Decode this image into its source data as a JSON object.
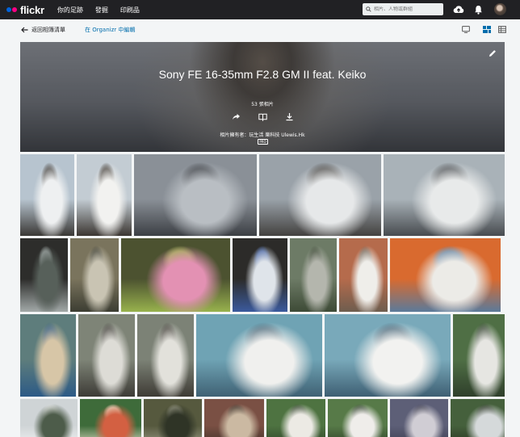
{
  "nav": {
    "logo": "flickr",
    "items": [
      "你的足跡",
      "發掘",
      "印刷品"
    ],
    "search_placeholder": "相片、人物或群組"
  },
  "toolbar": {
    "back_label": "返回相簿清單",
    "organizr_label": "在 Organizr 中編輯"
  },
  "album": {
    "title": "Sony FE 16-35mm F2.8 GM II feat. Keiko",
    "count": "53 張相片",
    "owner": "相片擁有者：玩生活 樂科技 Ulewis.Hk",
    "license": "PRO"
  },
  "colors": {
    "brand_blue": "#0063dc",
    "brand_pink": "#ff0084",
    "link": "#006dac",
    "topbar": "#212124"
  },
  "photos": [
    {
      "row": 1,
      "subject": "girl with clear umbrella, sea and sky",
      "palette": [
        "#b7c4cf",
        "#eef0f1",
        "#3a3835"
      ]
    },
    {
      "row": 1,
      "subject": "girl with clear umbrella close-up",
      "palette": [
        "#c3ccd3",
        "#f2f2f0",
        "#3b3631"
      ]
    },
    {
      "row": 1,
      "subject": "clear umbrella over harbour",
      "palette": [
        "#8a9097",
        "#b9bec3",
        "#3c3f44"
      ]
    },
    {
      "row": 1,
      "subject": "girl in white under umbrella, ferry",
      "palette": [
        "#9aa2a9",
        "#e6e8e9",
        "#43413f"
      ]
    },
    {
      "row": 1,
      "subject": "girl with umbrella by the pier",
      "palette": [
        "#a9b2b8",
        "#e8eaea",
        "#474b4f"
      ]
    },
    {
      "row": 2,
      "subject": "balcony railing with trees",
      "palette": [
        "#2d2d2b",
        "#57605a",
        "#a2a9a8"
      ]
    },
    {
      "row": 2,
      "subject": "old building with hanging plants",
      "palette": [
        "#7a745d",
        "#c9c4b3",
        "#3c3d32"
      ]
    },
    {
      "row": 2,
      "subject": "pink toy with green leaves",
      "palette": [
        "#4c5230",
        "#e391b3",
        "#98b24d"
      ]
    },
    {
      "row": 2,
      "subject": "blue and white ceramic figure",
      "palette": [
        "#2c2b29",
        "#dfe4ea",
        "#3b5a9d"
      ]
    },
    {
      "row": 2,
      "subject": "village house with greenery",
      "palette": [
        "#6d7b66",
        "#b4b6ad",
        "#3d4a36"
      ]
    },
    {
      "row": 2,
      "subject": "girl sitting by red wall",
      "palette": [
        "#b56b4c",
        "#efeeea",
        "#6e5d4e"
      ]
    },
    {
      "row": 2,
      "subject": "girl with orange crates",
      "palette": [
        "#d96a2f",
        "#ecebe7",
        "#5b7a9a"
      ]
    },
    {
      "row": 3,
      "subject": "graffiti wall",
      "palette": [
        "#5e7d7c",
        "#d7c6a7",
        "#2c5a86"
      ]
    },
    {
      "row": 3,
      "subject": "girl with umbrella near plants",
      "palette": [
        "#7e8477",
        "#dddcd6",
        "#3d3b36"
      ]
    },
    {
      "row": 3,
      "subject": "girl with umbrella near plants 2",
      "palette": [
        "#7c8276",
        "#e2e1db",
        "#3e3b35"
      ]
    },
    {
      "row": 3,
      "subject": "white clog shoes on painted floor",
      "palette": [
        "#6fa3b4",
        "#f0f0ee",
        "#3f6174"
      ]
    },
    {
      "row": 3,
      "subject": "white clog shoes close-up",
      "palette": [
        "#79a9ba",
        "#f2f2f0",
        "#3e5f73"
      ]
    },
    {
      "row": 3,
      "subject": "girl with umbrella on green path",
      "palette": [
        "#4f6f45",
        "#e6e6e2",
        "#2f3f2b"
      ]
    },
    {
      "row": 4,
      "subject": "cloudy sky and rooftop",
      "palette": [
        "#cfd4d6",
        "#4d5c4a",
        "#f3f4f4"
      ]
    },
    {
      "row": 4,
      "subject": "colorful shrine",
      "palette": [
        "#3e6b3a",
        "#d36042",
        "#e5e0c9"
      ]
    },
    {
      "row": 4,
      "subject": "tree roots on wall",
      "palette": [
        "#56593e",
        "#2f3426",
        "#9a9b86"
      ]
    },
    {
      "row": 4,
      "subject": "brick building",
      "palette": [
        "#7a5044",
        "#cbb9a2",
        "#3d3029"
      ]
    },
    {
      "row": 4,
      "subject": "girl in green foliage",
      "palette": [
        "#4e7341",
        "#eceae4",
        "#2d4127"
      ]
    },
    {
      "row": 4,
      "subject": "girl under trees",
      "palette": [
        "#577a48",
        "#efedea",
        "#2b3e26"
      ]
    },
    {
      "row": 4,
      "subject": "street posters",
      "palette": [
        "#5d5f77",
        "#d0cdd4",
        "#3a3b4e"
      ]
    },
    {
      "row": 4,
      "subject": "tall trees and sky",
      "palette": [
        "#45603c",
        "#d5d9da",
        "#27331f"
      ]
    }
  ]
}
